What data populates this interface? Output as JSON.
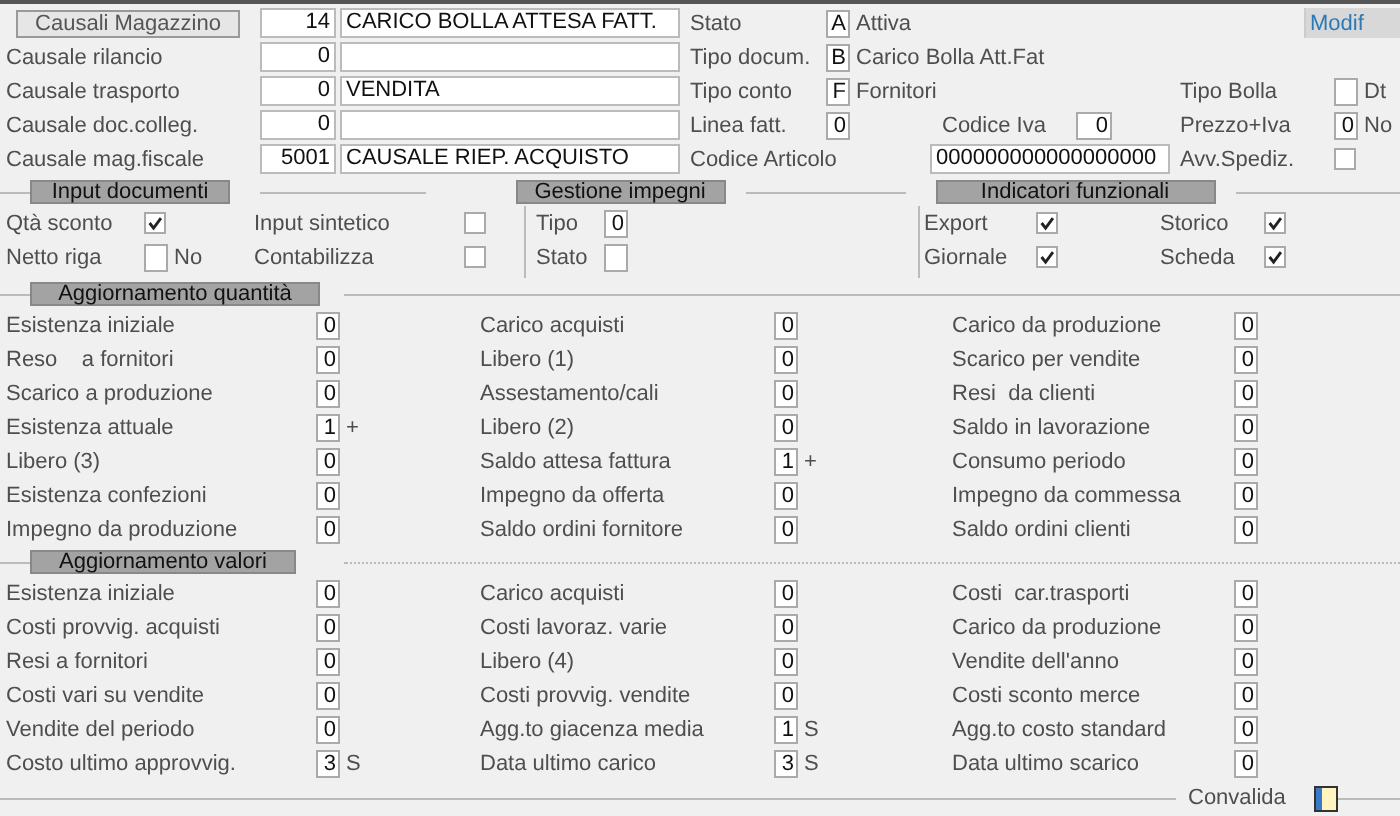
{
  "top_rows": [
    {
      "causale": {
        "kind": "button",
        "label": "Causali Magazzino",
        "code": "14",
        "description": "CARICO BOLLA ATTESA FATT."
      },
      "documento": {
        "kind": "code",
        "label": "Stato",
        "code": "A",
        "text": "Attiva"
      },
      "opzione": {
        "kind": "button",
        "label": "Modif"
      }
    },
    {
      "causale": {
        "kind": "label",
        "label": "Causale rilancio",
        "code": "0"
      },
      "documento": {
        "kind": "code",
        "label": "Tipo docum.",
        "code": "B",
        "text": "Carico Bolla Att.Fat"
      }
    },
    {
      "causale": {
        "kind": "label",
        "label": "Causale trasporto",
        "code": "0",
        "description": "VENDITA"
      },
      "documento": {
        "kind": "code",
        "label": "Tipo conto",
        "code": "F",
        "text": "Fornitori"
      },
      "opzione": {
        "kind": "box",
        "label": "Tipo Bolla",
        "suffix": "Dt"
      }
    },
    {
      "causale": {
        "kind": "label",
        "label": "Causale doc.colleg.",
        "code": "0"
      },
      "documento": {
        "kind": "pair",
        "label": "Linea fatt.",
        "code": "0",
        "label_2": "Codice Iva",
        "code_2": "0"
      },
      "opzione": {
        "kind": "box",
        "label": "Prezzo+Iva",
        "value": "0",
        "suffix": "No"
      }
    },
    {
      "causale": {
        "kind": "label",
        "label": "Causale mag.fiscale",
        "code": "5001",
        "description": "CAUSALE RIEP. ACQUISTO"
      },
      "documento": {
        "kind": "field",
        "label": "Codice Articolo",
        "value": "000000000000000000"
      },
      "opzione": {
        "kind": "checkbox",
        "label": "Avv.Spediz.",
        "checked": false
      }
    }
  ],
  "input_documenti": {
    "title": "Input documenti",
    "items": [
      {
        "kind": "checkbox",
        "label": "Qtà sconto",
        "checked": true
      },
      {
        "kind": "box",
        "label": "Netto riga",
        "suffix": "No"
      },
      {
        "kind": "checkbox",
        "label": "Input sintetico",
        "checked": false
      },
      {
        "kind": "checkbox",
        "label": "Contabilizza",
        "checked": false
      }
    ]
  },
  "gestione_impegni": {
    "title": "Gestione impegni",
    "items": [
      {
        "kind": "box",
        "label": "Tipo",
        "value": "0"
      },
      {
        "kind": "box",
        "label": "Stato"
      }
    ]
  },
  "indicatori_funzionali": {
    "title": "Indicatori funzionali",
    "items": [
      {
        "kind": "checkbox",
        "label": "Export",
        "checked": true
      },
      {
        "kind": "checkbox",
        "label": "Giornale",
        "checked": true
      },
      {
        "kind": "checkbox",
        "label": "Storico",
        "checked": true
      },
      {
        "kind": "checkbox",
        "label": "Scheda",
        "checked": true
      }
    ]
  },
  "aggiornamento_quantita": {
    "title": "Aggiornamento quantità",
    "items": [
      {
        "label": "Esistenza iniziale",
        "value": "0"
      },
      {
        "label": "Reso    a fornitori",
        "value": "0"
      },
      {
        "label": "Scarico a produzione",
        "value": "0"
      },
      {
        "label": "Esistenza attuale",
        "value": "1",
        "suffix": "+"
      },
      {
        "label": "Libero (3)",
        "value": "0"
      },
      {
        "label": "Esistenza confezioni",
        "value": "0"
      },
      {
        "label": "Impegno da produzione",
        "value": "0"
      },
      {
        "label": "Carico acquisti",
        "value": "0"
      },
      {
        "label": "Libero (1)",
        "value": "0"
      },
      {
        "label": "Assestamento/cali",
        "value": "0"
      },
      {
        "label": "Libero (2)",
        "value": "0"
      },
      {
        "label": "Saldo attesa fattura",
        "value": "1",
        "suffix": "+"
      },
      {
        "label": "Impegno da offerta",
        "value": "0"
      },
      {
        "label": "Saldo ordini fornitore",
        "value": "0"
      },
      {
        "label": "Carico da produzione",
        "value": "0"
      },
      {
        "label": "Scarico per vendite",
        "value": "0"
      },
      {
        "label": "Resi  da clienti",
        "value": "0"
      },
      {
        "label": "Saldo in lavorazione",
        "value": "0"
      },
      {
        "label": "Consumo periodo",
        "value": "0"
      },
      {
        "label": "Impegno da commessa",
        "value": "0"
      },
      {
        "label": "Saldo ordini clienti",
        "value": "0"
      }
    ]
  },
  "aggiornamento_valori": {
    "title": "Aggiornamento valori",
    "items": [
      {
        "label": "Esistenza iniziale",
        "value": "0"
      },
      {
        "label": "Costi provvig. acquisti",
        "value": "0"
      },
      {
        "label": "Resi a fornitori",
        "value": "0"
      },
      {
        "label": "Costi vari su vendite",
        "value": "0"
      },
      {
        "label": "Vendite del periodo",
        "value": "0"
      },
      {
        "label": "Costo ultimo approvvig.",
        "value": "3",
        "suffix": "S"
      },
      {
        "label": "Carico acquisti",
        "value": "0"
      },
      {
        "label": "Costi lavoraz. varie",
        "value": "0"
      },
      {
        "label": "Libero (4)",
        "value": "0"
      },
      {
        "label": "Costi provvig. vendite",
        "value": "0"
      },
      {
        "label": "Agg.to giacenza media",
        "value": "1",
        "suffix": "S"
      },
      {
        "label": "Data ultimo carico",
        "value": "3",
        "suffix": "S"
      },
      {
        "label": "Costi  car.trasporti",
        "value": "0"
      },
      {
        "label": "Carico da produzione",
        "value": "0"
      },
      {
        "label": "Vendite dell'anno",
        "value": "0"
      },
      {
        "label": "Costi sconto merce",
        "value": "0"
      },
      {
        "label": "Agg.to costo standard",
        "value": "0"
      },
      {
        "label": "Data ultimo scarico",
        "value": "0"
      }
    ]
  },
  "convalida": {
    "label": "Convalida"
  }
}
